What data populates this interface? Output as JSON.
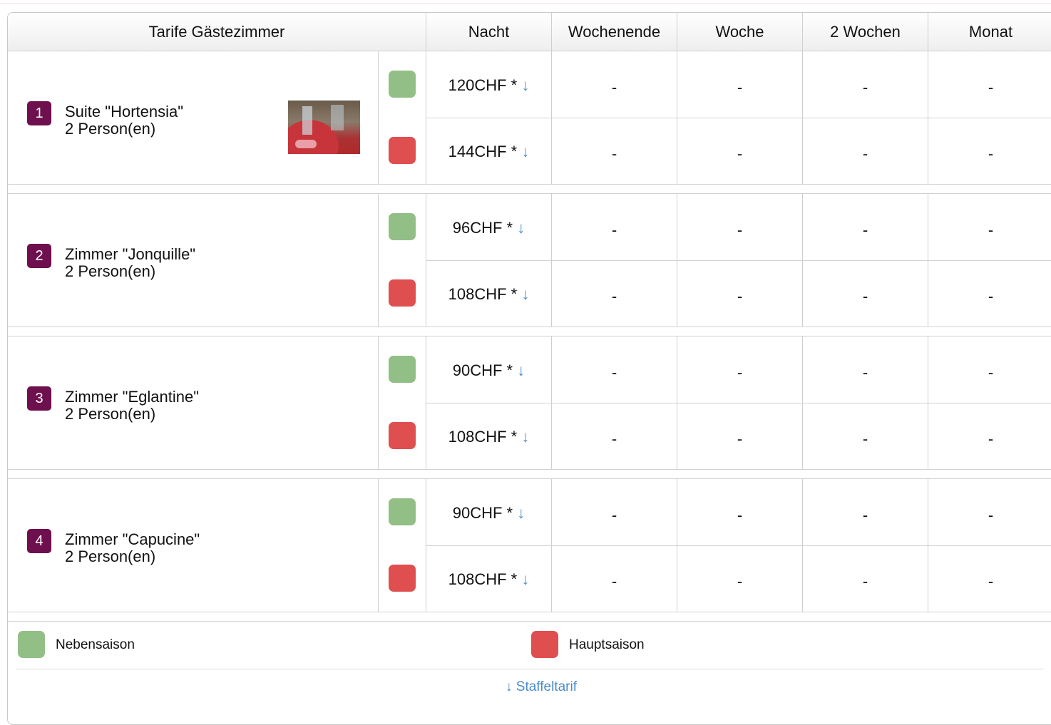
{
  "header": {
    "title": "Tarife Gästezimmer",
    "columns": [
      "Nacht",
      "Wochenende",
      "Woche",
      "2 Wochen",
      "Monat"
    ]
  },
  "rooms": [
    {
      "number": "1",
      "name": "Suite \"Hortensia\"",
      "persons": "2 Person(en)",
      "has_photo": true,
      "rates": [
        {
          "season": "Nebensaison",
          "night": "120CHF *",
          "arrow": "↓",
          "weekend": "-",
          "week": "-",
          "two_weeks": "-",
          "month": "-"
        },
        {
          "season": "Hauptsaison",
          "night": "144CHF *",
          "arrow": "↓",
          "weekend": "-",
          "week": "-",
          "two_weeks": "-",
          "month": "-"
        }
      ]
    },
    {
      "number": "2",
      "name": "Zimmer \"Jonquille\"",
      "persons": "2 Person(en)",
      "has_photo": false,
      "rates": [
        {
          "season": "Nebensaison",
          "night": "96CHF *",
          "arrow": "↓",
          "weekend": "-",
          "week": "-",
          "two_weeks": "-",
          "month": "-"
        },
        {
          "season": "Hauptsaison",
          "night": "108CHF *",
          "arrow": "↓",
          "weekend": "-",
          "week": "-",
          "two_weeks": "-",
          "month": "-"
        }
      ]
    },
    {
      "number": "3",
      "name": "Zimmer \"Eglantine\"",
      "persons": "2 Person(en)",
      "has_photo": false,
      "rates": [
        {
          "season": "Nebensaison",
          "night": "90CHF *",
          "arrow": "↓",
          "weekend": "-",
          "week": "-",
          "two_weeks": "-",
          "month": "-"
        },
        {
          "season": "Hauptsaison",
          "night": "108CHF *",
          "arrow": "↓",
          "weekend": "-",
          "week": "-",
          "two_weeks": "-",
          "month": "-"
        }
      ]
    },
    {
      "number": "4",
      "name": "Zimmer \"Capucine\"",
      "persons": "2 Person(en)",
      "has_photo": false,
      "rates": [
        {
          "season": "Nebensaison",
          "night": "90CHF *",
          "arrow": "↓",
          "weekend": "-",
          "week": "-",
          "two_weeks": "-",
          "month": "-"
        },
        {
          "season": "Hauptsaison",
          "night": "108CHF *",
          "arrow": "↓",
          "weekend": "-",
          "week": "-",
          "two_weeks": "-",
          "month": "-"
        }
      ]
    }
  ],
  "legend": {
    "low_season": {
      "label": "Nebensaison",
      "color": "#92bf86"
    },
    "high_season": {
      "label": "Hauptsaison",
      "color": "#df4f4f"
    }
  },
  "footer": {
    "tiered_rate_link": "↓ Staffeltarif"
  },
  "colors": {
    "badge": "#6e0f4e",
    "link": "#4a8ac9",
    "border": "#cfcfcf"
  }
}
